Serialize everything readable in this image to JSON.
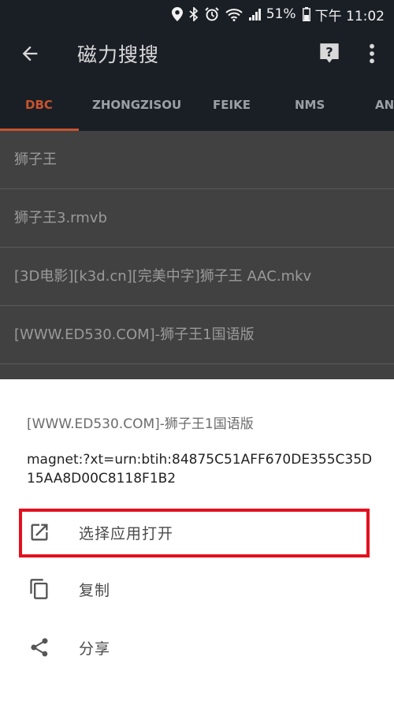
{
  "status_bar": {
    "battery": "51%",
    "time": "下午 11:02"
  },
  "app_bar": {
    "title": "磁力搜搜"
  },
  "tabs": [
    {
      "label": "DBC",
      "active": true
    },
    {
      "label": "ZHONGZISOU",
      "active": false
    },
    {
      "label": "FEIKE",
      "active": false
    },
    {
      "label": "NMS",
      "active": false
    },
    {
      "label": "AN",
      "active": false
    }
  ],
  "results": [
    "狮子王",
    "狮子王3.rmvb",
    "[3D电影][k3d.cn][完美中字]狮子王 AAC.mkv",
    "[WWW.ED530.COM]-狮子王1国语版"
  ],
  "sheet": {
    "item_name": "[WWW.ED530.COM]-狮子王1国语版",
    "magnet_link": "magnet:?xt=urn:btih:84875C51AFF670DE355C35D15AA8D00C8118F1B2",
    "actions": [
      {
        "label": "选择应用打开",
        "icon": "open-in-new-icon"
      },
      {
        "label": "复制",
        "icon": "copy-icon"
      },
      {
        "label": "分享",
        "icon": "share-icon"
      }
    ]
  },
  "colors": {
    "app_bar": "#1a1f26",
    "accent": "#c8532e",
    "highlight": "#e3101f"
  }
}
